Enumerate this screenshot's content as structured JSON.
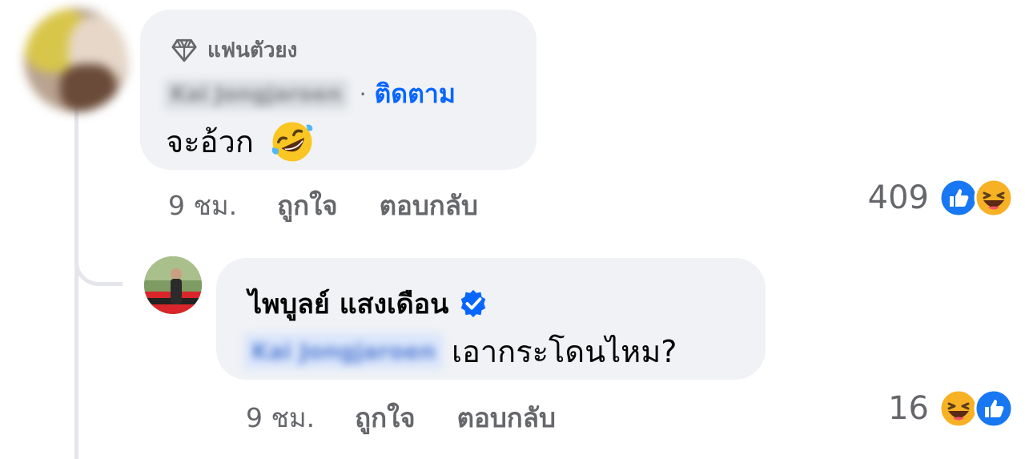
{
  "comment": {
    "badge_label": "แฟนตัวยง",
    "badge_icon": "diamond-icon",
    "author_name": "Kai Jongjaroen",
    "separator": "·",
    "follow_label": "ติดตาม",
    "text": "จะอ้วก",
    "emoji": "rolling-on-floor-laughing-emoji",
    "time": "9 ชม.",
    "like_label": "ถูกใจ",
    "reply_label": "ตอบกลับ",
    "reaction_count": "409",
    "reactions": [
      "like-reaction-icon",
      "haha-reaction-icon"
    ]
  },
  "reply": {
    "author_name": "ไพบูลย์ แสงเดือน",
    "verified_icon": "verified-badge-icon",
    "mention": "Kai Jongjaroen",
    "text": "เอากระโดนไหม?",
    "time": "9 ชม.",
    "like_label": "ถูกใจ",
    "reply_label": "ตอบกลับ",
    "reaction_count": "16",
    "reactions": [
      "haha-reaction-icon",
      "like-reaction-icon"
    ]
  },
  "colors": {
    "bubble": "#f0f2f5",
    "link": "#0866ff",
    "secondary_text": "#65676b",
    "like_blue": "#1877f2",
    "haha_yellow": "#f7b125"
  }
}
